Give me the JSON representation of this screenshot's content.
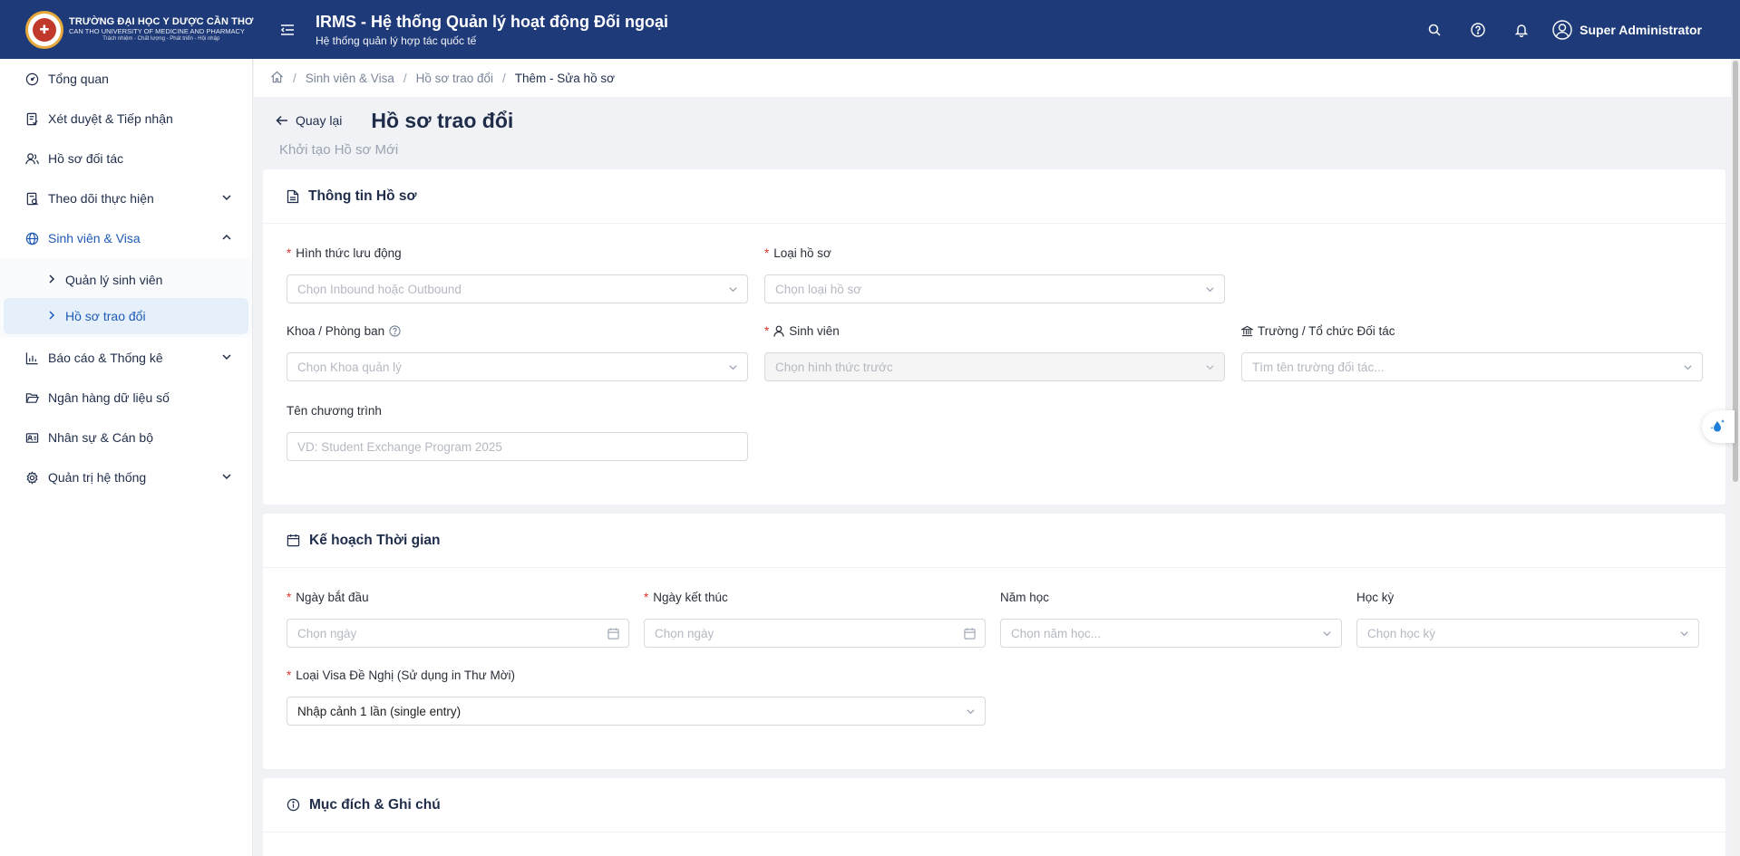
{
  "header": {
    "logo": {
      "line1": "TRƯỜNG ĐẠI HỌC Y DƯỢC CẦN THƠ",
      "line2": "CAN THO UNIVERSITY OF MEDICINE AND PHARMACY",
      "line3": "Trách nhiệm - Chất lượng - Phát triển - Hội nhập"
    },
    "title": "IRMS - Hệ thống Quản lý hoạt động Đối ngoại",
    "subtitle": "Hệ thống quản lý hợp tác quốc tế",
    "user_name": "Super Administrator",
    "colors": {
      "bg": "#1e3a78",
      "accent": "#1e5ab6",
      "required": "#e0342d"
    }
  },
  "sidebar": {
    "items": [
      {
        "label": "Tổng quan",
        "icon": "dashboard-icon"
      },
      {
        "label": "Xét duyệt & Tiếp nhận",
        "icon": "clipboard-check-icon"
      },
      {
        "label": "Hồ sơ đối tác",
        "icon": "partner-icon"
      },
      {
        "label": "Theo dõi thực hiện",
        "icon": "tracking-icon",
        "expandable": true
      },
      {
        "label": "Sinh viên & Visa",
        "icon": "globe-icon",
        "expanded": true
      },
      {
        "label": "Báo cáo & Thống kê",
        "icon": "bar-chart-icon",
        "expandable": true
      },
      {
        "label": "Ngân hàng dữ liệu số",
        "icon": "folder-open-icon"
      },
      {
        "label": "Nhân sự & Cán bộ",
        "icon": "id-card-icon"
      },
      {
        "label": "Quản trị hệ thống",
        "icon": "settings-icon",
        "expandable": true
      }
    ],
    "sub_items": [
      {
        "label": "Quản lý sinh viên"
      },
      {
        "label": "Hồ sơ trao đổi",
        "selected": true
      }
    ]
  },
  "breadcrumb": {
    "items": [
      "Sinh viên & Visa",
      "Hồ sơ trao đổi"
    ],
    "current": "Thêm - Sửa hồ sơ"
  },
  "page": {
    "back_label": "Quay lại",
    "title": "Hồ sơ trao đổi",
    "subtitle": "Khởi tạo Hồ sơ Mới"
  },
  "sections": {
    "info": {
      "title": "Thông tin Hồ sơ",
      "mobility_label": "Hình thức lưu động",
      "mobility_placeholder": "Chọn Inbound hoặc Outbound",
      "type_label": "Loại hồ sơ",
      "type_placeholder": "Chọn loại hồ sơ",
      "faculty_label": "Khoa / Phòng ban",
      "faculty_placeholder": "Chọn Khoa quản lý",
      "student_label": "Sinh viên",
      "student_placeholder": "Chọn hình thức trước",
      "partner_label": "Trường / Tổ chức Đối tác",
      "partner_placeholder": "Tìm tên trường đối tác...",
      "program_label": "Tên chương trình",
      "program_placeholder": "VD: Student Exchange Program 2025"
    },
    "schedule": {
      "title": "Kế hoạch Thời gian",
      "start_label": "Ngày bắt đầu",
      "start_placeholder": "Chọn ngày",
      "end_label": "Ngày kết thúc",
      "end_placeholder": "Chọn ngày",
      "year_label": "Năm học",
      "year_placeholder": "Chọn năm học...",
      "semester_label": "Học kỳ",
      "semester_placeholder": "Chọn học kỳ",
      "visa_label": "Loại Visa Đề Nghị (Sử dụng in Thư Mời)",
      "visa_value": "Nhập cảnh 1 lần (single entry)"
    },
    "purpose": {
      "title": "Mục đích & Ghi chú"
    }
  }
}
